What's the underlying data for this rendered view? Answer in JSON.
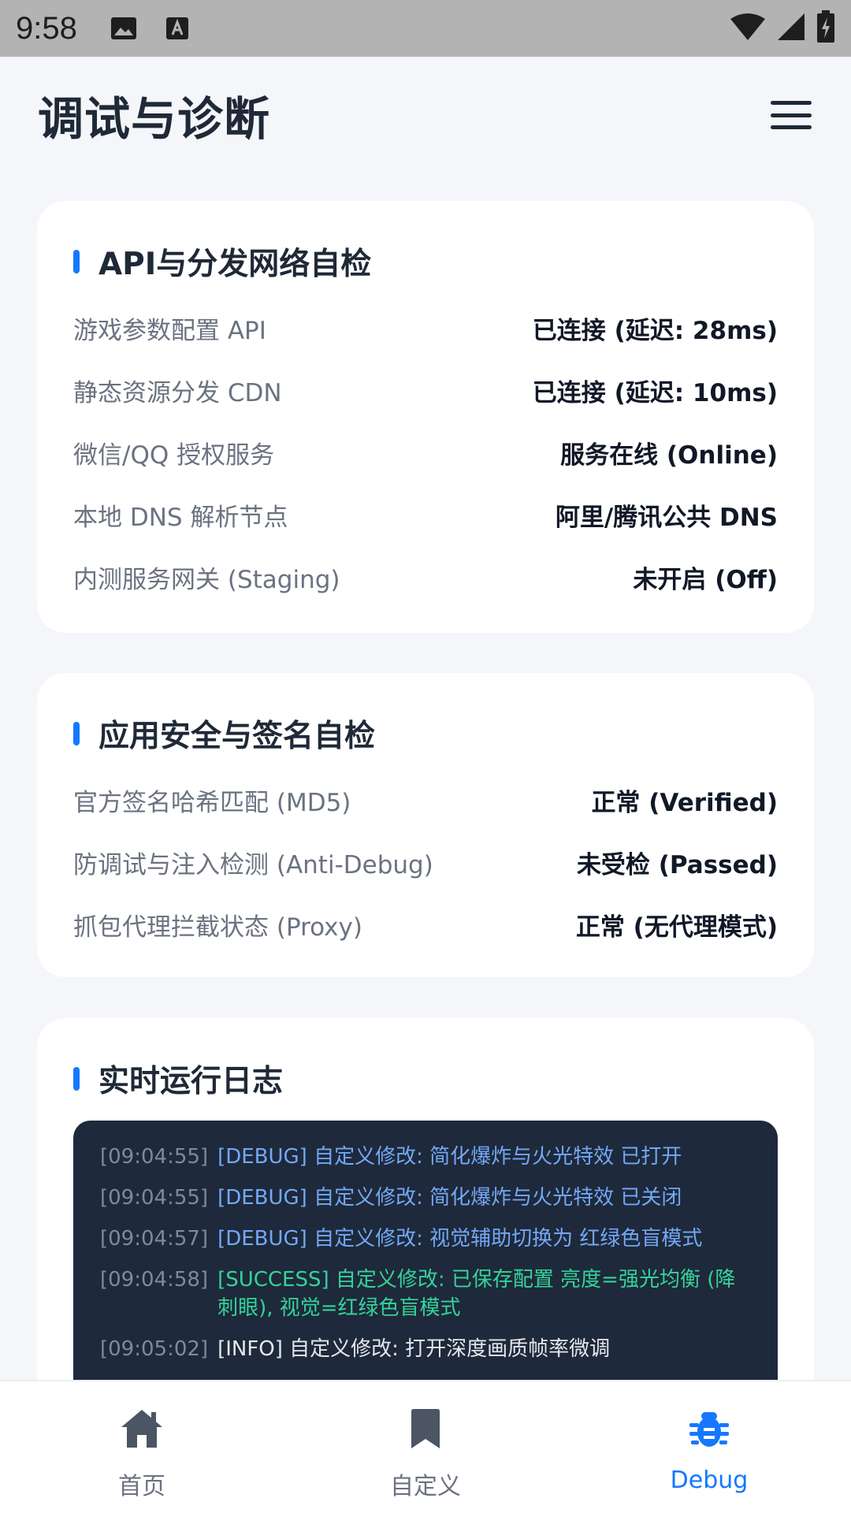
{
  "status_bar": {
    "time": "9:58"
  },
  "header": {
    "title": "调试与诊断",
    "menu_icon": "hamburger-menu-icon"
  },
  "api_section": {
    "title": "API与分发网络自检",
    "rows": [
      {
        "label": "游戏参数配置 API",
        "value": "已连接 (延迟: 28ms)"
      },
      {
        "label": "静态资源分发 CDN",
        "value": "已连接 (延迟: 10ms)"
      },
      {
        "label": "微信/QQ 授权服务",
        "value": "服务在线 (Online)"
      },
      {
        "label": "本地 DNS 解析节点",
        "value": "阿里/腾讯公共 DNS"
      },
      {
        "label": "内测服务网关 (Staging)",
        "value": "未开启 (Off)"
      }
    ]
  },
  "security_section": {
    "title": "应用安全与签名自检",
    "rows": [
      {
        "label": "官方签名哈希匹配 (MD5)",
        "value": "正常 (Verified)"
      },
      {
        "label": "防调试与注入检测 (Anti-Debug)",
        "value": "未受检 (Passed)"
      },
      {
        "label": "抓包代理拦截状态 (Proxy)",
        "value": "正常 (无代理模式)"
      }
    ]
  },
  "log_section": {
    "title": "实时运行日志",
    "entries": [
      {
        "time": "[09:04:55]",
        "message": "[DEBUG] 自定义修改: 简化爆炸与火光特效 已打开",
        "level": "debug"
      },
      {
        "time": "[09:04:55]",
        "message": "[DEBUG] 自定义修改: 简化爆炸与火光特效 已关闭",
        "level": "debug"
      },
      {
        "time": "[09:04:57]",
        "message": "[DEBUG] 自定义修改: 视觉辅助切换为 红绿色盲模式",
        "level": "debug"
      },
      {
        "time": "[09:04:58]",
        "message": "[SUCCESS] 自定义修改: 已保存配置 亮度=强光均衡 (降刺眼), 视觉=红绿色盲模式",
        "level": "success"
      },
      {
        "time": "[09:05:02]",
        "message": "[INFO] 自定义修改: 打开深度画质帧率微调",
        "level": "info"
      }
    ]
  },
  "bottom_nav": {
    "items": [
      {
        "label": "首页",
        "icon": "home-icon",
        "active": false
      },
      {
        "label": "自定义",
        "icon": "bookmark-icon",
        "active": false
      },
      {
        "label": "Debug",
        "icon": "bug-icon",
        "active": true
      }
    ]
  },
  "colors": {
    "accent": "#1677ff",
    "log_background": "#1e293b",
    "log_debug": "#73a8f5",
    "log_success": "#34d399",
    "log_info": "#e5e7eb"
  }
}
